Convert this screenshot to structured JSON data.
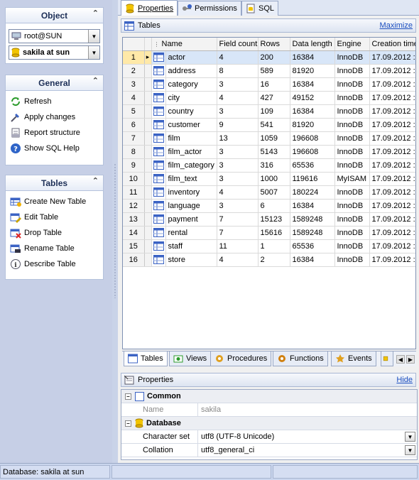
{
  "left_panel": {
    "object": {
      "title": "Object",
      "connection": "root@SUN",
      "database": "sakila at sun"
    },
    "general": {
      "title": "General",
      "items": [
        {
          "label": "Refresh",
          "icon": "refresh-icon"
        },
        {
          "label": "Apply changes",
          "icon": "apply-changes-icon"
        },
        {
          "label": "Report structure",
          "icon": "report-icon"
        },
        {
          "label": "Show SQL Help",
          "icon": "help-icon"
        }
      ]
    },
    "tables": {
      "title": "Tables",
      "items": [
        {
          "label": "Create New Table",
          "icon": "create-table-icon"
        },
        {
          "label": "Edit Table",
          "icon": "edit-table-icon"
        },
        {
          "label": "Drop Table",
          "icon": "drop-table-icon"
        },
        {
          "label": "Rename Table",
          "icon": "rename-table-icon"
        },
        {
          "label": "Describe Table",
          "icon": "info-icon"
        }
      ]
    }
  },
  "top_tabs": [
    {
      "label": "Properties",
      "active": true
    },
    {
      "label": "Permissions",
      "active": false
    },
    {
      "label": "SQL",
      "active": false
    }
  ],
  "tables_panel": {
    "title": "Tables",
    "maximize": "Maximize",
    "columns": [
      "Name",
      "Field count",
      "Rows",
      "Data length",
      "Engine",
      "Creation time"
    ],
    "rows": [
      {
        "n": "1",
        "name": "actor",
        "fields": "4",
        "rows": "200",
        "len": "16384",
        "engine": "InnoDB",
        "created": "17.09.2012 :"
      },
      {
        "n": "2",
        "name": "address",
        "fields": "8",
        "rows": "589",
        "len": "81920",
        "engine": "InnoDB",
        "created": "17.09.2012 :"
      },
      {
        "n": "3",
        "name": "category",
        "fields": "3",
        "rows": "16",
        "len": "16384",
        "engine": "InnoDB",
        "created": "17.09.2012 :"
      },
      {
        "n": "4",
        "name": "city",
        "fields": "4",
        "rows": "427",
        "len": "49152",
        "engine": "InnoDB",
        "created": "17.09.2012 :"
      },
      {
        "n": "5",
        "name": "country",
        "fields": "3",
        "rows": "109",
        "len": "16384",
        "engine": "InnoDB",
        "created": "17.09.2012 :"
      },
      {
        "n": "6",
        "name": "customer",
        "fields": "9",
        "rows": "541",
        "len": "81920",
        "engine": "InnoDB",
        "created": "17.09.2012 :"
      },
      {
        "n": "7",
        "name": "film",
        "fields": "13",
        "rows": "1059",
        "len": "196608",
        "engine": "InnoDB",
        "created": "17.09.2012 :"
      },
      {
        "n": "8",
        "name": "film_actor",
        "fields": "3",
        "rows": "5143",
        "len": "196608",
        "engine": "InnoDB",
        "created": "17.09.2012 :"
      },
      {
        "n": "9",
        "name": "film_category",
        "fields": "3",
        "rows": "316",
        "len": "65536",
        "engine": "InnoDB",
        "created": "17.09.2012 :"
      },
      {
        "n": "10",
        "name": "film_text",
        "fields": "3",
        "rows": "1000",
        "len": "119616",
        "engine": "MyISAM",
        "created": "17.09.2012 :"
      },
      {
        "n": "11",
        "name": "inventory",
        "fields": "4",
        "rows": "5007",
        "len": "180224",
        "engine": "InnoDB",
        "created": "17.09.2012 :"
      },
      {
        "n": "12",
        "name": "language",
        "fields": "3",
        "rows": "6",
        "len": "16384",
        "engine": "InnoDB",
        "created": "17.09.2012 :"
      },
      {
        "n": "13",
        "name": "payment",
        "fields": "7",
        "rows": "15123",
        "len": "1589248",
        "engine": "InnoDB",
        "created": "17.09.2012 :"
      },
      {
        "n": "14",
        "name": "rental",
        "fields": "7",
        "rows": "15616",
        "len": "1589248",
        "engine": "InnoDB",
        "created": "17.09.2012 :"
      },
      {
        "n": "15",
        "name": "staff",
        "fields": "11",
        "rows": "1",
        "len": "65536",
        "engine": "InnoDB",
        "created": "17.09.2012 :"
      },
      {
        "n": "16",
        "name": "store",
        "fields": "4",
        "rows": "2",
        "len": "16384",
        "engine": "InnoDB",
        "created": "17.09.2012 :"
      }
    ]
  },
  "bottom_tabs": [
    {
      "label": "Tables",
      "active": true
    },
    {
      "label": "Views",
      "active": false
    },
    {
      "label": "Procedures",
      "active": false
    },
    {
      "label": "Functions",
      "active": false
    },
    {
      "label": "Events",
      "active": false
    }
  ],
  "properties_panel": {
    "title": "Properties",
    "hide": "Hide",
    "common": {
      "title": "Common",
      "name_label": "Name",
      "name_value": "sakila"
    },
    "database": {
      "title": "Database",
      "charset_label": "Character set",
      "charset_value": "utf8 (UTF-8 Unicode)",
      "collation_label": "Collation",
      "collation_value": "utf8_general_ci"
    }
  },
  "status": {
    "text": "Database: sakila at sun"
  },
  "colors": {
    "selected_row": "#d8e6f8",
    "link": "#1c4fc0",
    "panel_bg": "#c6cfe6"
  }
}
